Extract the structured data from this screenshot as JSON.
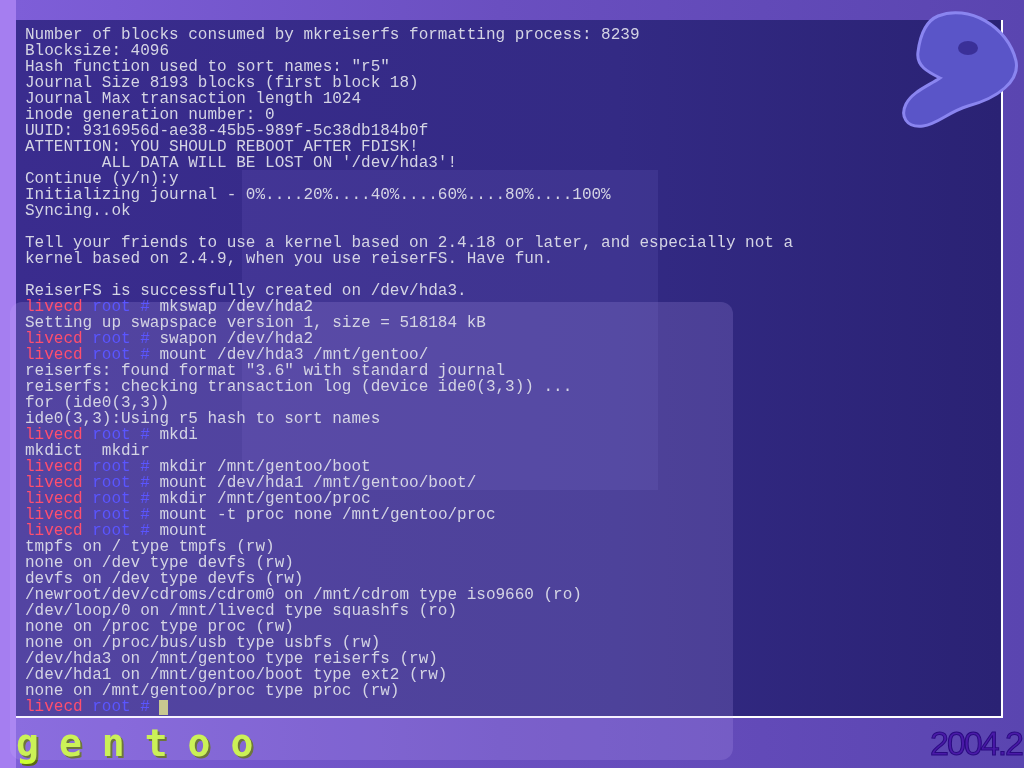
{
  "console": {
    "lines": [
      {
        "kind": "output",
        "text": "Number of blocks consumed by mkreiserfs formatting process: 8239"
      },
      {
        "kind": "output",
        "text": "Blocksize: 4096"
      },
      {
        "kind": "output",
        "text": "Hash function used to sort names: \"r5\""
      },
      {
        "kind": "output",
        "text": "Journal Size 8193 blocks (first block 18)"
      },
      {
        "kind": "output",
        "text": "Journal Max transaction length 1024"
      },
      {
        "kind": "output",
        "text": "inode generation number: 0"
      },
      {
        "kind": "output",
        "text": "UUID: 9316956d-ae38-45b5-989f-5c38db184b0f"
      },
      {
        "kind": "output",
        "text": "ATTENTION: YOU SHOULD REBOOT AFTER FDISK!"
      },
      {
        "kind": "output",
        "text": "        ALL DATA WILL BE LOST ON '/dev/hda3'!"
      },
      {
        "kind": "output",
        "text": "Continue (y/n):y"
      },
      {
        "kind": "output",
        "text": "Initializing journal - 0%....20%....40%....60%....80%....100%"
      },
      {
        "kind": "output",
        "text": "Syncing..ok"
      },
      {
        "kind": "blank"
      },
      {
        "kind": "output",
        "text": "Tell your friends to use a kernel based on 2.4.18 or later, and especially not a"
      },
      {
        "kind": "output",
        "text": "kernel based on 2.4.9, when you use reiserFS. Have fun."
      },
      {
        "kind": "blank"
      },
      {
        "kind": "output",
        "text": "ReiserFS is successfully created on /dev/hda3."
      },
      {
        "kind": "prompt",
        "host": "livecd",
        "user": "root",
        "symbol": "#",
        "command": "mkswap /dev/hda2",
        "cursor": false
      },
      {
        "kind": "output",
        "text": "Setting up swapspace version 1, size = 518184 kB"
      },
      {
        "kind": "prompt",
        "host": "livecd",
        "user": "root",
        "symbol": "#",
        "command": "swapon /dev/hda2",
        "cursor": false
      },
      {
        "kind": "prompt",
        "host": "livecd",
        "user": "root",
        "symbol": "#",
        "command": "mount /dev/hda3 /mnt/gentoo/",
        "cursor": false
      },
      {
        "kind": "output",
        "text": "reiserfs: found format \"3.6\" with standard journal"
      },
      {
        "kind": "output",
        "text": "reiserfs: checking transaction log (device ide0(3,3)) ..."
      },
      {
        "kind": "output",
        "text": "for (ide0(3,3))"
      },
      {
        "kind": "output",
        "text": "ide0(3,3):Using r5 hash to sort names"
      },
      {
        "kind": "prompt",
        "host": "livecd",
        "user": "root",
        "symbol": "#",
        "command": "mkdi",
        "cursor": false
      },
      {
        "kind": "output",
        "text": "mkdict  mkdir"
      },
      {
        "kind": "prompt",
        "host": "livecd",
        "user": "root",
        "symbol": "#",
        "command": "mkdir /mnt/gentoo/boot",
        "cursor": false
      },
      {
        "kind": "prompt",
        "host": "livecd",
        "user": "root",
        "symbol": "#",
        "command": "mount /dev/hda1 /mnt/gentoo/boot/",
        "cursor": false
      },
      {
        "kind": "prompt",
        "host": "livecd",
        "user": "root",
        "symbol": "#",
        "command": "mkdir /mnt/gentoo/proc",
        "cursor": false
      },
      {
        "kind": "prompt",
        "host": "livecd",
        "user": "root",
        "symbol": "#",
        "command": "mount -t proc none /mnt/gentoo/proc",
        "cursor": false
      },
      {
        "kind": "prompt",
        "host": "livecd",
        "user": "root",
        "symbol": "#",
        "command": "mount",
        "cursor": false
      },
      {
        "kind": "output",
        "text": "tmpfs on / type tmpfs (rw)"
      },
      {
        "kind": "output",
        "text": "none on /dev type devfs (rw)"
      },
      {
        "kind": "output",
        "text": "devfs on /dev type devfs (rw)"
      },
      {
        "kind": "output",
        "text": "/newroot/dev/cdroms/cdrom0 on /mnt/cdrom type iso9660 (ro)"
      },
      {
        "kind": "output",
        "text": "/dev/loop/0 on /mnt/livecd type squashfs (ro)"
      },
      {
        "kind": "output",
        "text": "none on /proc type proc (rw)"
      },
      {
        "kind": "output",
        "text": "none on /proc/bus/usb type usbfs (rw)"
      },
      {
        "kind": "output",
        "text": "/dev/hda3 on /mnt/gentoo type reiserfs (rw)"
      },
      {
        "kind": "output",
        "text": "/dev/hda1 on /mnt/gentoo/boot type ext2 (rw)"
      },
      {
        "kind": "output",
        "text": "none on /mnt/gentoo/proc type proc (rw)"
      },
      {
        "kind": "prompt",
        "host": "livecd",
        "user": "root",
        "symbol": "#",
        "cursor": true
      }
    ]
  },
  "branding": {
    "wordmark": "gentoo",
    "version": "2004.2"
  }
}
